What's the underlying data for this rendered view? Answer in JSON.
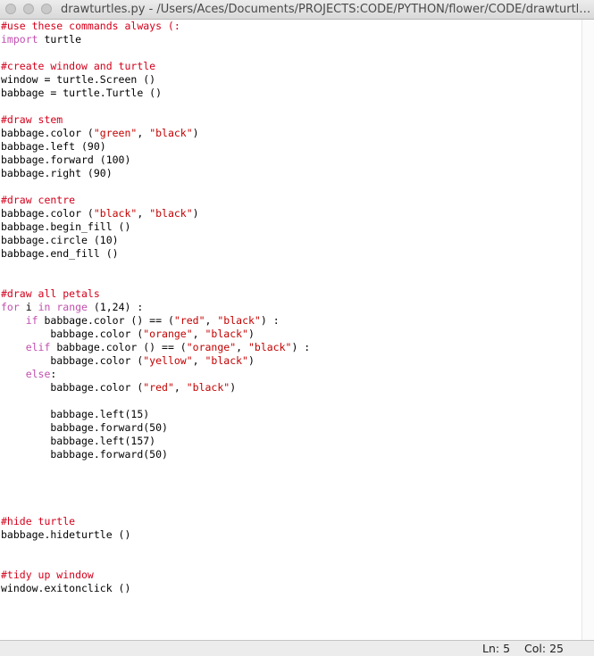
{
  "window": {
    "title": "drawturtles.py - /Users/Aces/Documents/PROJECTS:CODE/PYTHON/flower/CODE/drawturtles...."
  },
  "editor": {
    "lines": [
      [
        {
          "t": "#use these commands always (:",
          "c": "comment"
        }
      ],
      [
        {
          "t": "import",
          "c": "kw"
        },
        {
          "t": " turtle"
        }
      ],
      [],
      [
        {
          "t": "#create window and turtle",
          "c": "comment"
        }
      ],
      [
        {
          "t": "window = turtle.Screen ()"
        }
      ],
      [
        {
          "t": "babbage = turtle.Turtle ()"
        }
      ],
      [],
      [
        {
          "t": "#draw stem",
          "c": "comment"
        }
      ],
      [
        {
          "t": "babbage.color ("
        },
        {
          "t": "\"green\"",
          "c": "str"
        },
        {
          "t": ", "
        },
        {
          "t": "\"black\"",
          "c": "str"
        },
        {
          "t": ")"
        }
      ],
      [
        {
          "t": "babbage.left (90)"
        }
      ],
      [
        {
          "t": "babbage.forward (100)"
        }
      ],
      [
        {
          "t": "babbage.right (90)"
        }
      ],
      [],
      [
        {
          "t": "#draw centre",
          "c": "comment"
        }
      ],
      [
        {
          "t": "babbage.color ("
        },
        {
          "t": "\"black\"",
          "c": "str"
        },
        {
          "t": ", "
        },
        {
          "t": "\"black\"",
          "c": "str"
        },
        {
          "t": ")"
        }
      ],
      [
        {
          "t": "babbage.begin_fill ()"
        }
      ],
      [
        {
          "t": "babbage.circle (10)"
        }
      ],
      [
        {
          "t": "babbage.end_fill ()"
        }
      ],
      [],
      [],
      [
        {
          "t": "#draw all petals",
          "c": "comment"
        }
      ],
      [
        {
          "t": "for",
          "c": "kw"
        },
        {
          "t": " i "
        },
        {
          "t": "in",
          "c": "kw"
        },
        {
          "t": " "
        },
        {
          "t": "range",
          "c": "kw"
        },
        {
          "t": " (1,24) :"
        }
      ],
      [
        {
          "t": "    "
        },
        {
          "t": "if",
          "c": "kw"
        },
        {
          "t": " babbage.color () == ("
        },
        {
          "t": "\"red\"",
          "c": "str"
        },
        {
          "t": ", "
        },
        {
          "t": "\"black\"",
          "c": "str"
        },
        {
          "t": ") :"
        }
      ],
      [
        {
          "t": "        babbage.color ("
        },
        {
          "t": "\"orange\"",
          "c": "str"
        },
        {
          "t": ", "
        },
        {
          "t": "\"black\"",
          "c": "str"
        },
        {
          "t": ")"
        }
      ],
      [
        {
          "t": "    "
        },
        {
          "t": "elif",
          "c": "kw"
        },
        {
          "t": " babbage.color () == ("
        },
        {
          "t": "\"orange\"",
          "c": "str"
        },
        {
          "t": ", "
        },
        {
          "t": "\"black\"",
          "c": "str"
        },
        {
          "t": ") :"
        }
      ],
      [
        {
          "t": "        babbage.color ("
        },
        {
          "t": "\"yellow\"",
          "c": "str"
        },
        {
          "t": ", "
        },
        {
          "t": "\"black\"",
          "c": "str"
        },
        {
          "t": ")"
        }
      ],
      [
        {
          "t": "    "
        },
        {
          "t": "else",
          "c": "kw"
        },
        {
          "t": ":"
        }
      ],
      [
        {
          "t": "        babbage.color ("
        },
        {
          "t": "\"red\"",
          "c": "str"
        },
        {
          "t": ", "
        },
        {
          "t": "\"black\"",
          "c": "str"
        },
        {
          "t": ")"
        }
      ],
      [],
      [
        {
          "t": "        babbage.left(15)"
        }
      ],
      [
        {
          "t": "        babbage.forward(50)"
        }
      ],
      [
        {
          "t": "        babbage.left(157)"
        }
      ],
      [
        {
          "t": "        babbage.forward(50)"
        }
      ],
      [],
      [],
      [],
      [],
      [
        {
          "t": "#hide turtle",
          "c": "comment"
        }
      ],
      [
        {
          "t": "babbage.hideturtle ()"
        }
      ],
      [],
      [],
      [
        {
          "t": "#tidy up window",
          "c": "comment"
        }
      ],
      [
        {
          "t": "window.exitonclick ()"
        }
      ]
    ]
  },
  "status": {
    "line": "Ln: 5",
    "col": "Col: 25"
  },
  "colors": {
    "comment": "#d4001b",
    "keyword": "#c24fae",
    "string": "#c40000",
    "text": "#000000"
  }
}
